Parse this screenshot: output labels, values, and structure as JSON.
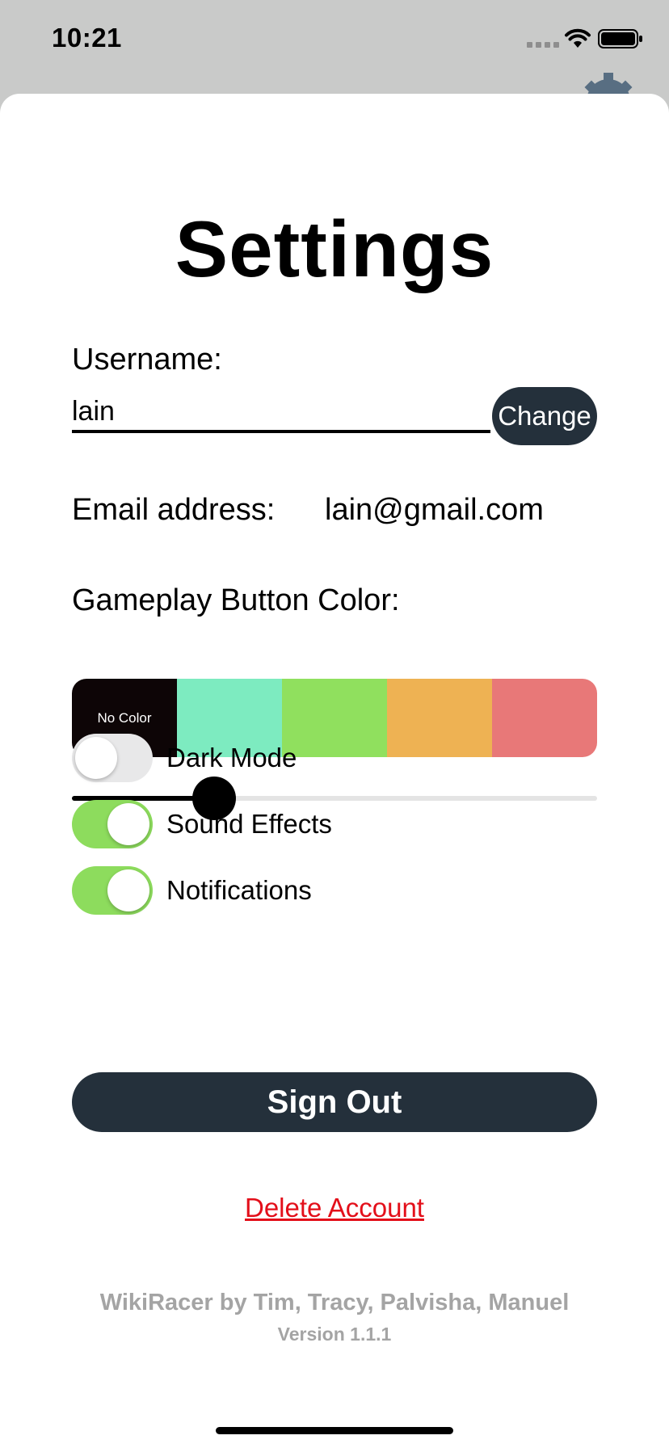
{
  "status_bar": {
    "time": "10:21"
  },
  "title": "Settings",
  "username": {
    "label": "Username:",
    "value": "lain",
    "change_label": "Change"
  },
  "email": {
    "label": "Email address:",
    "value": "lain@gmail.com"
  },
  "gameplay_color": {
    "label": "Gameplay Button Color:",
    "swatches": [
      {
        "label": "No Color",
        "color": "#0d0506"
      },
      {
        "label": "",
        "color": "#7debc0"
      },
      {
        "label": "",
        "color": "#90e05e"
      },
      {
        "label": "",
        "color": "#eeb253"
      },
      {
        "label": "",
        "color": "#e87878"
      }
    ],
    "slider_value": 0.27
  },
  "toggles": [
    {
      "label": "Dark Mode",
      "on": false
    },
    {
      "label": "Sound Effects",
      "on": true
    },
    {
      "label": "Notifications",
      "on": true
    }
  ],
  "sign_out_label": "Sign Out",
  "delete_account_label": "Delete Account",
  "credits": "WikiRacer by Tim, Tracy, Palvisha, Manuel",
  "version": "Version 1.1.1",
  "colors": {
    "dark_button": "#24303b",
    "toggle_on": "#8ddc5d",
    "danger": "#e30f1a"
  }
}
